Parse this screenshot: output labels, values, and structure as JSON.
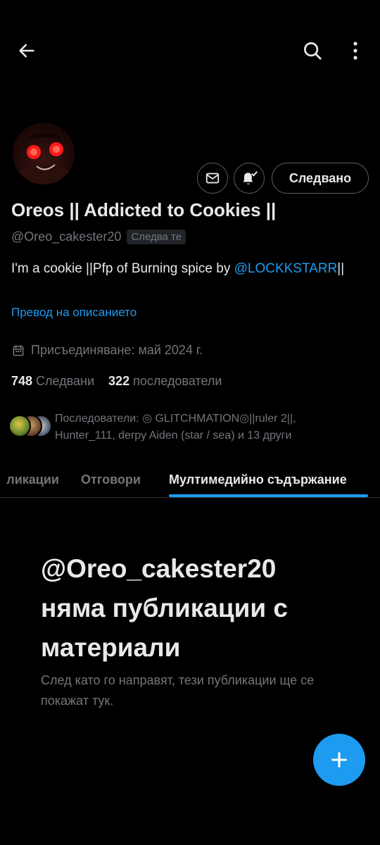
{
  "colors": {
    "background": "#000000",
    "text_primary": "#e7e9ea",
    "text_secondary": "#71767b",
    "accent": "#1d9bf0",
    "border": "#536471"
  },
  "topbar": {
    "back_icon": "arrow-left-icon",
    "search_icon": "search-icon",
    "more_icon": "more-vertical-icon"
  },
  "profile": {
    "display_name": "Oreos || Addicted to Cookies ||",
    "handle": "@Oreo_cakester20",
    "follows_you_badge": "Следва те",
    "bio_text": "I'm a cookie ||Pfp of Burning spice by ",
    "bio_mention": "@LOCKKSTARR",
    "bio_suffix": "||",
    "translate_link": "Превод на описанието",
    "joined": "Присъединяване: май 2024 г."
  },
  "actions": {
    "message_icon": "envelope-icon",
    "notifications_icon": "bell-check-icon",
    "following_label": "Следвано"
  },
  "stats": {
    "following_count": "748",
    "following_label": "Следвани",
    "followers_count": "322",
    "followers_label": "последователи"
  },
  "followers_you_know": {
    "text": "Последователи: ◎ GLITCHMATION◎||ruler 2||, Hunter_111, derpy Aiden (star / sea) и 13 други"
  },
  "tabs": [
    {
      "label": "Публикации",
      "visible_text": "ликации",
      "active": false
    },
    {
      "label": "Отговори",
      "active": false
    },
    {
      "label": "Мултимедийно съдържание",
      "active": true
    }
  ],
  "empty_state": {
    "title": "@Oreo_cakester20 няма публикации с материали",
    "subtitle": "След като го направят, тези публикации ще се покажат тук."
  },
  "fab": {
    "icon": "plus-icon"
  }
}
